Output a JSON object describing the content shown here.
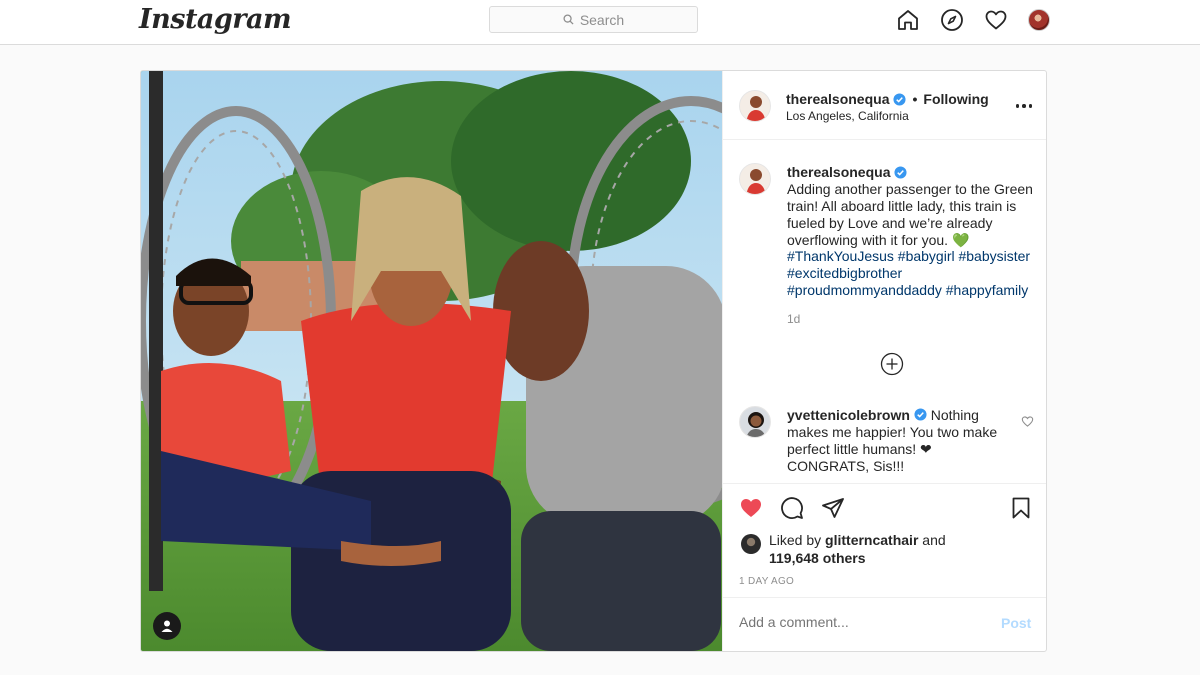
{
  "nav": {
    "logo": "Instagram",
    "search_placeholder": "Search",
    "icons": [
      "home-icon",
      "explore-icon",
      "activity-heart-icon",
      "profile-avatar"
    ]
  },
  "post": {
    "author": "therealsonequa",
    "verified": true,
    "follow_status": "Following",
    "location": "Los Angeles, California",
    "caption": {
      "author": "therealsonequa",
      "text": "Adding another passenger to the Green train! All aboard little lady, this train is fueled by Love and we’re already overflowing with it for you. 💚",
      "hashtags": "#ThankYouJesus #babygirl #babysister #excitedbigbrother #proudmommyanddaddy #happyfamily",
      "time": "1d"
    },
    "comments": [
      {
        "author": "yvettenicolebrown",
        "verified": true,
        "text": "Nothing makes me happier! You two make perfect little humans! ❤ CONGRATS, Sis!!!"
      }
    ],
    "likes": {
      "liked_by_prefix": "Liked by",
      "liked_by_user": "glitterncathair",
      "and_text": "and",
      "others_count": "119,648 others"
    },
    "date_label": "1 DAY AGO",
    "comment_placeholder": "Add a comment...",
    "post_button": "Post"
  },
  "colors": {
    "like_red": "#ed4956",
    "verified_blue": "#3897f0",
    "hashtag_blue": "#00376b",
    "post_disabled": "#b3dbff"
  }
}
